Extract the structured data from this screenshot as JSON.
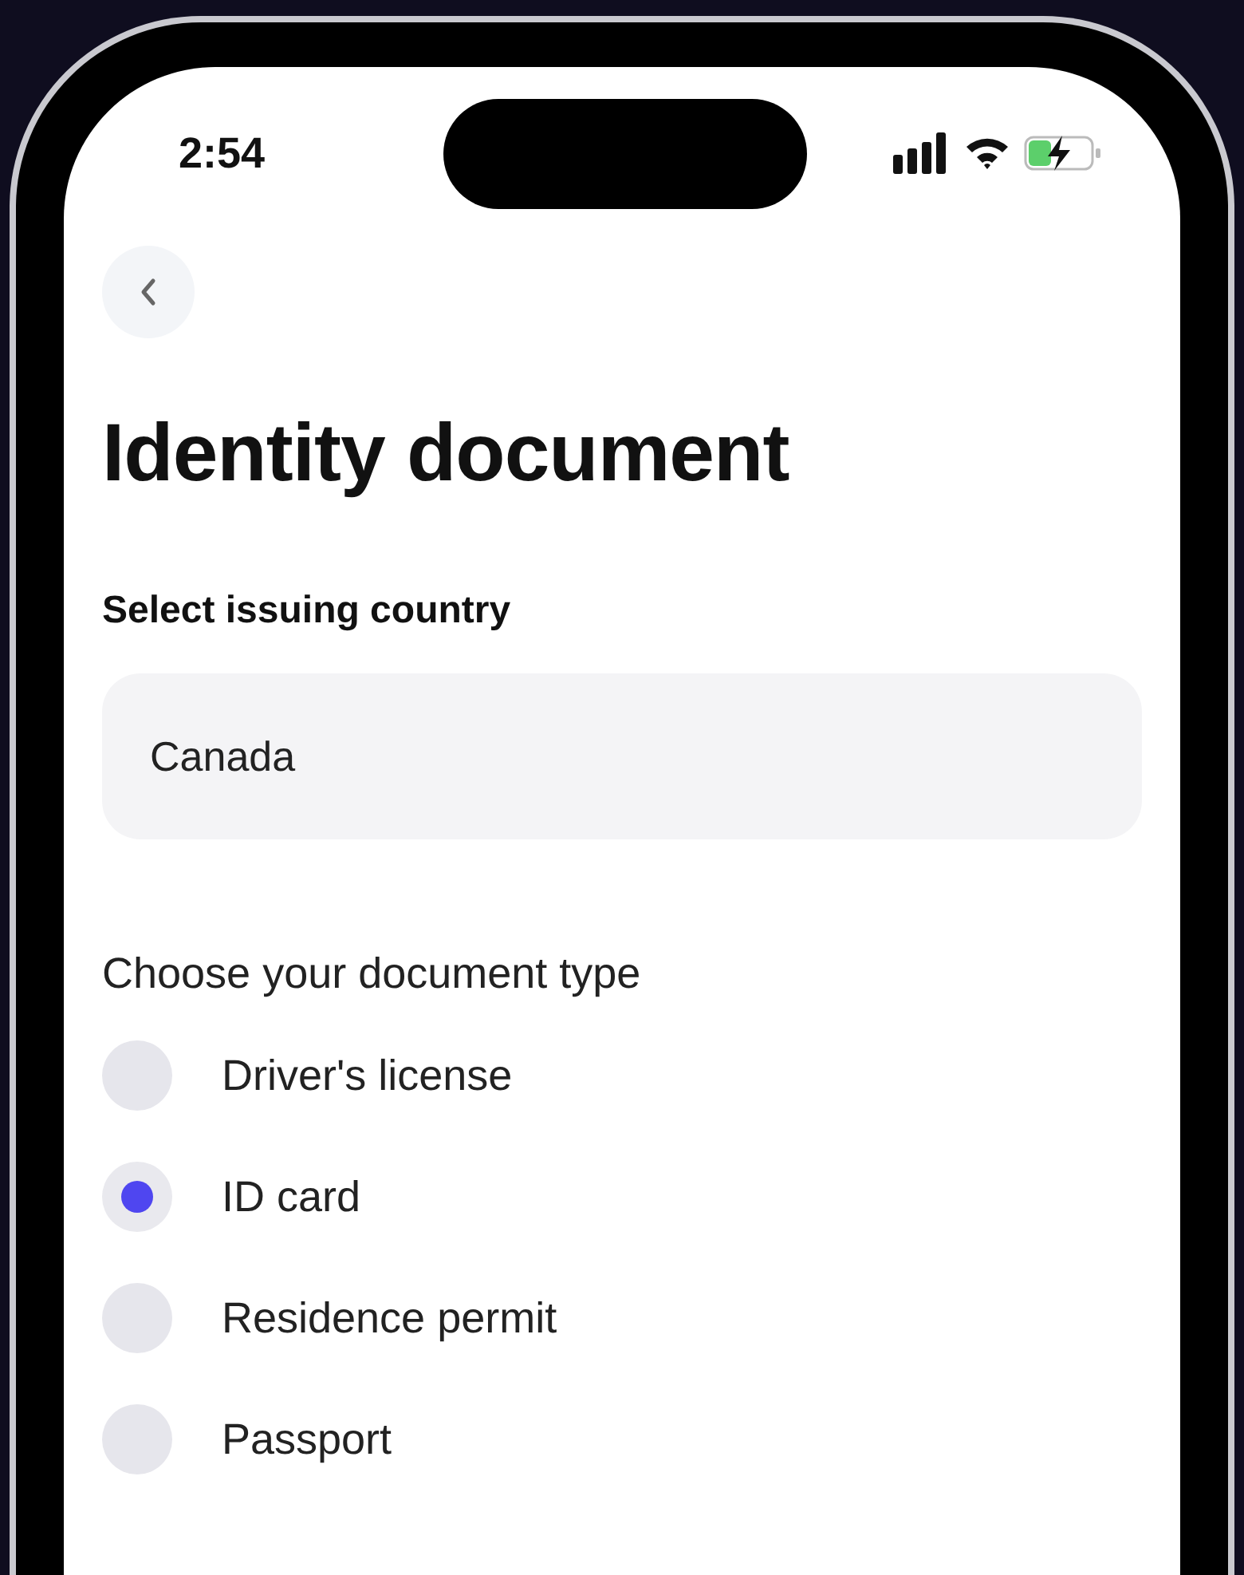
{
  "status_bar": {
    "time": "2:54"
  },
  "title": "Identity document",
  "country": {
    "label": "Select issuing country",
    "value": "Canada"
  },
  "document_type": {
    "label": "Choose your document type",
    "options": [
      {
        "label": "Driver's license",
        "selected": false
      },
      {
        "label": "ID card",
        "selected": true
      },
      {
        "label": "Residence permit",
        "selected": false
      },
      {
        "label": "Passport",
        "selected": false
      }
    ]
  }
}
